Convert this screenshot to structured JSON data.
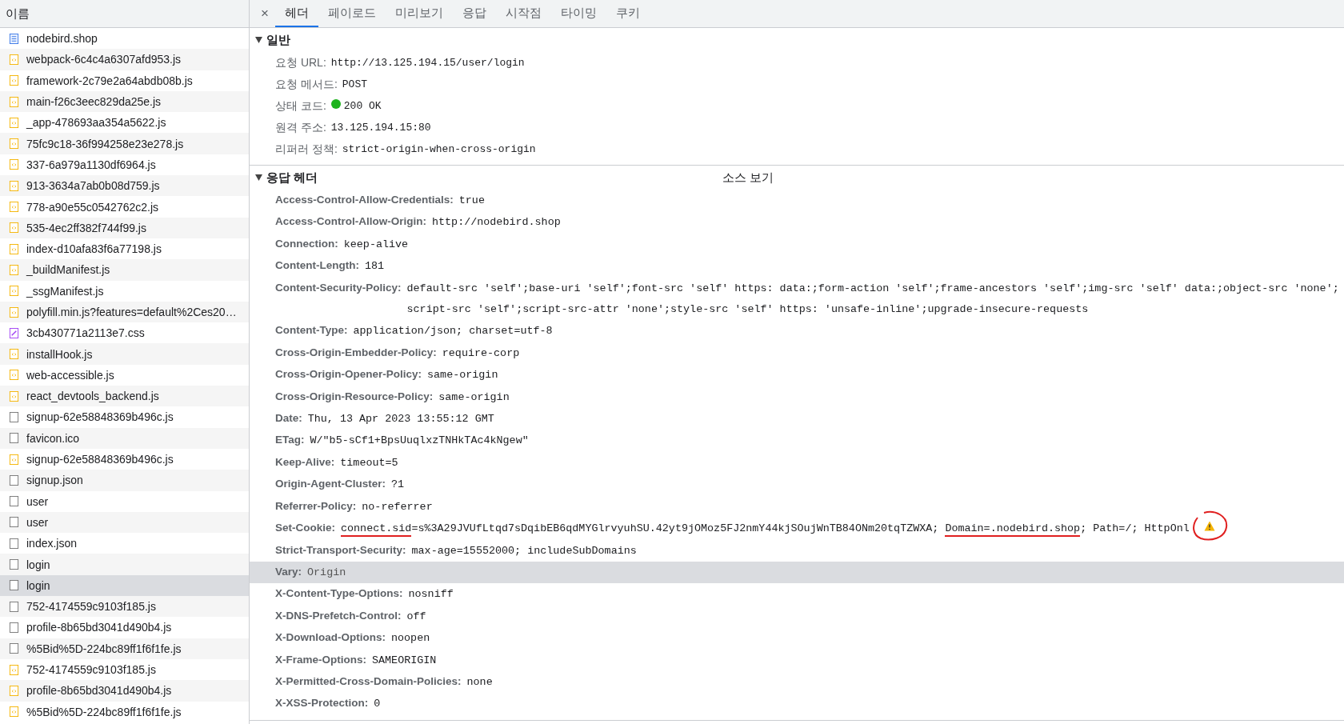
{
  "file_list": {
    "header": "이름",
    "items": [
      {
        "name": "nodebird.shop",
        "kind": "document",
        "selected": false
      },
      {
        "name": "webpack-6c4c4a6307afd953.js",
        "kind": "script",
        "selected": false
      },
      {
        "name": "framework-2c79e2a64abdb08b.js",
        "kind": "script",
        "selected": false
      },
      {
        "name": "main-f26c3eec829da25e.js",
        "kind": "script",
        "selected": false
      },
      {
        "name": "_app-478693aa354a5622.js",
        "kind": "script",
        "selected": false
      },
      {
        "name": "75fc9c18-36f994258e23e278.js",
        "kind": "script",
        "selected": false
      },
      {
        "name": "337-6a979a1130df6964.js",
        "kind": "script",
        "selected": false
      },
      {
        "name": "913-3634a7ab0b08d759.js",
        "kind": "script",
        "selected": false
      },
      {
        "name": "778-a90e55c0542762c2.js",
        "kind": "script",
        "selected": false
      },
      {
        "name": "535-4ec2ff382f744f99.js",
        "kind": "script",
        "selected": false
      },
      {
        "name": "index-d10afa83f6a77198.js",
        "kind": "script",
        "selected": false
      },
      {
        "name": "_buildManifest.js",
        "kind": "script",
        "selected": false
      },
      {
        "name": "_ssgManifest.js",
        "kind": "script",
        "selected": false
      },
      {
        "name": "polyfill.min.js?features=default%2Ces20…",
        "kind": "script",
        "selected": false
      },
      {
        "name": "3cb430771a2113e7.css",
        "kind": "stylesheet",
        "selected": false
      },
      {
        "name": "installHook.js",
        "kind": "script",
        "selected": false
      },
      {
        "name": "web-accessible.js",
        "kind": "script",
        "selected": false
      },
      {
        "name": "react_devtools_backend.js",
        "kind": "script",
        "selected": false
      },
      {
        "name": "signup-62e58848369b496c.js",
        "kind": "other",
        "selected": false
      },
      {
        "name": "favicon.ico",
        "kind": "other",
        "selected": false
      },
      {
        "name": "signup-62e58848369b496c.js",
        "kind": "script",
        "selected": false
      },
      {
        "name": "signup.json",
        "kind": "other",
        "selected": false
      },
      {
        "name": "user",
        "kind": "other",
        "selected": false
      },
      {
        "name": "user",
        "kind": "other",
        "selected": false
      },
      {
        "name": "index.json",
        "kind": "other",
        "selected": false
      },
      {
        "name": "login",
        "kind": "other",
        "selected": false
      },
      {
        "name": "login",
        "kind": "other",
        "selected": true
      },
      {
        "name": "752-4174559c9103f185.js",
        "kind": "other",
        "selected": false
      },
      {
        "name": "profile-8b65bd3041d490b4.js",
        "kind": "other",
        "selected": false
      },
      {
        "name": "%5Bid%5D-224bc89ff1f6f1fe.js",
        "kind": "other",
        "selected": false
      },
      {
        "name": "752-4174559c9103f185.js",
        "kind": "script",
        "selected": false
      },
      {
        "name": "profile-8b65bd3041d490b4.js",
        "kind": "script",
        "selected": false
      },
      {
        "name": "%5Bid%5D-224bc89ff1f6f1fe.js",
        "kind": "script",
        "selected": false
      }
    ]
  },
  "close_button": "×",
  "tabs": [
    {
      "label": "헤더",
      "selected": true
    },
    {
      "label": "페이로드",
      "selected": false
    },
    {
      "label": "미리보기",
      "selected": false
    },
    {
      "label": "응답",
      "selected": false
    },
    {
      "label": "시작점",
      "selected": false
    },
    {
      "label": "타이밍",
      "selected": false
    },
    {
      "label": "쿠키",
      "selected": false
    }
  ],
  "general": {
    "title": "일반",
    "expanded": true,
    "rows": [
      {
        "label": "요청 URL:",
        "value": "http://13.125.194.15/user/login",
        "kind": "plain"
      },
      {
        "label": "요청 메서드:",
        "value": "POST",
        "kind": "plain"
      },
      {
        "label": "상태 코드:",
        "value": "200 OK",
        "kind": "status"
      },
      {
        "label": "원격 주소:",
        "value": "13.125.194.15:80",
        "kind": "plain"
      },
      {
        "label": "리퍼러 정책:",
        "value": "strict-origin-when-cross-origin",
        "kind": "plain"
      }
    ]
  },
  "response_headers": {
    "title": "응답 헤더",
    "expanded": true,
    "view_source_link": "소스 보기",
    "rows": [
      {
        "name": "Access-Control-Allow-Credentials:",
        "value": "true",
        "highlighted": false
      },
      {
        "name": "Access-Control-Allow-Origin:",
        "value": "http://nodebird.shop",
        "highlighted": false
      },
      {
        "name": "Connection:",
        "value": "keep-alive",
        "highlighted": false
      },
      {
        "name": "Content-Length:",
        "value": "181",
        "highlighted": false
      },
      {
        "name": "Content-Security-Policy:",
        "value": "default-src 'self';base-uri 'self';font-src 'self' https: data:;form-action 'self';frame-ancestors 'self';img-src 'self' data:;object-src 'none';script-src 'self';script-src-attr 'none';style-src 'self' https: 'unsafe-inline';upgrade-insecure-requests",
        "highlighted": false
      },
      {
        "name": "Content-Type:",
        "value": "application/json; charset=utf-8",
        "highlighted": false
      },
      {
        "name": "Cross-Origin-Embedder-Policy:",
        "value": "require-corp",
        "highlighted": false
      },
      {
        "name": "Cross-Origin-Opener-Policy:",
        "value": "same-origin",
        "highlighted": false
      },
      {
        "name": "Cross-Origin-Resource-Policy:",
        "value": "same-origin",
        "highlighted": false
      },
      {
        "name": "Date:",
        "value": "Thu, 13 Apr 2023 13:55:12 GMT",
        "highlighted": false
      },
      {
        "name": "ETag:",
        "value": "W/\"b5-sCf1+BpsUuqlxzTNHkTAc4kNgew\"",
        "highlighted": false
      },
      {
        "name": "Keep-Alive:",
        "value": "timeout=5",
        "highlighted": false
      },
      {
        "name": "Origin-Agent-Cluster:",
        "value": "?1",
        "highlighted": false
      },
      {
        "name": "Referrer-Policy:",
        "value": "no-referrer",
        "highlighted": false
      },
      {
        "name": "Set-Cookie:",
        "segments": [
          {
            "text": "connect.sid",
            "underlined": true
          },
          {
            "text": "=s%3A29JVUfLtqd7sDqibEB6qdMYGlrvyuhSU.42yt9jOMoz5FJ2nmY44kjSOujWnTB84ONm20tqTZWXA; ",
            "underlined": false
          },
          {
            "text": "Domain=.nodebird.shop",
            "underlined": true
          },
          {
            "text": "; Path=/; HttpOnl",
            "underlined": false
          }
        ],
        "warning": true,
        "warning_circled": true,
        "highlighted": false
      },
      {
        "name": "Strict-Transport-Security:",
        "value": "max-age=15552000; includeSubDomains",
        "highlighted": false
      },
      {
        "name": "Vary:",
        "value": "Origin",
        "highlighted": true
      },
      {
        "name": "X-Content-Type-Options:",
        "value": "nosniff",
        "highlighted": false
      },
      {
        "name": "X-DNS-Prefetch-Control:",
        "value": "off",
        "highlighted": false
      },
      {
        "name": "X-Download-Options:",
        "value": "noopen",
        "highlighted": false
      },
      {
        "name": "X-Frame-Options:",
        "value": "SAMEORIGIN",
        "highlighted": false
      },
      {
        "name": "X-Permitted-Cross-Domain-Policies:",
        "value": "none",
        "highlighted": false
      },
      {
        "name": "X-XSS-Protection:",
        "value": "0",
        "highlighted": false
      }
    ]
  }
}
